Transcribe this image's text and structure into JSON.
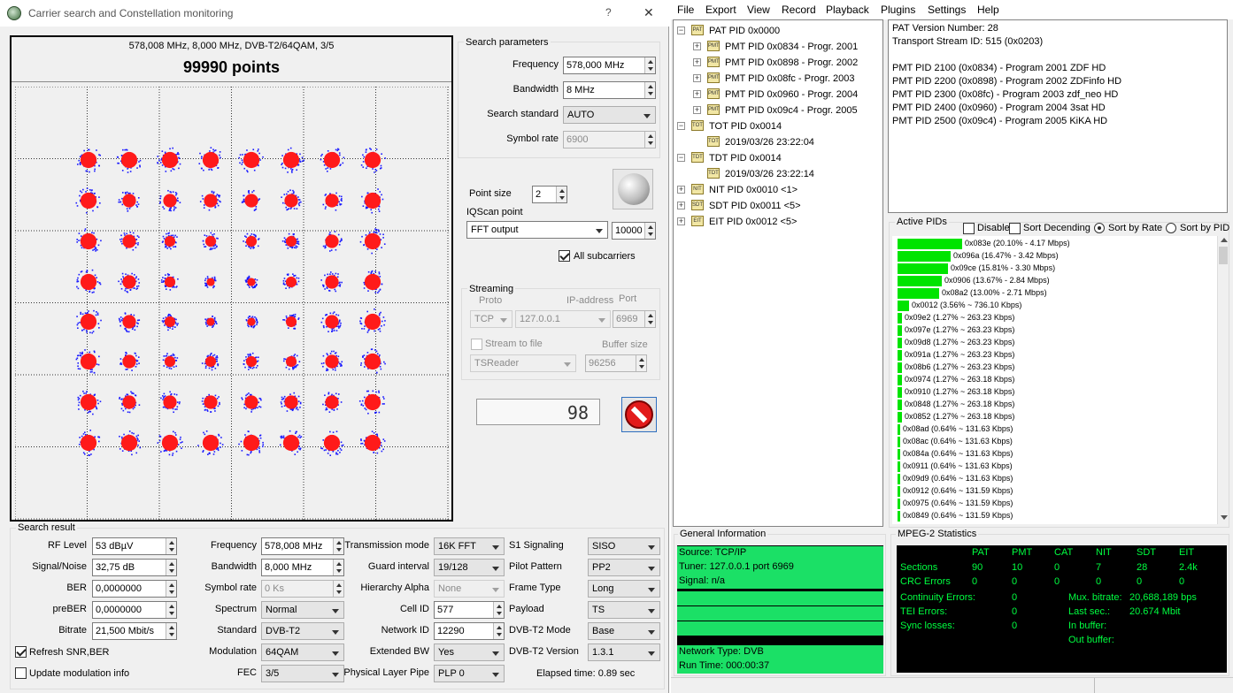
{
  "left_window": {
    "title": "Carrier search and Constellation monitoring",
    "help": "?",
    "close": "✕",
    "constellation": {
      "info_line": "578,008 MHz, 8,000 MHz, DVB-T2/64QAM, 3/5",
      "points": "99990 points"
    },
    "search_params": {
      "title": "Search parameters",
      "frequency_label": "Frequency",
      "frequency": "578,000 MHz",
      "bandwidth_label": "Bandwidth",
      "bandwidth": "8 MHz",
      "standard_label": "Search standard",
      "standard": "AUTO",
      "symbol_rate_label": "Symbol rate",
      "symbol_rate": "6900"
    },
    "point_size_label": "Point size",
    "point_size": "2",
    "iqscan_label": "IQScan point",
    "iqscan": "FFT output",
    "iqscan_count": "10000",
    "all_subcarriers": "All subcarriers",
    "streaming": {
      "title": "Streaming",
      "proto_label": "Proto",
      "ip_label": "IP-address",
      "port_label": "Port",
      "proto": "TCP",
      "ip": "127.0.0.1",
      "port": "6969",
      "stream_to_file": "Stream to file",
      "buffer_label": "Buffer size",
      "reader": "TSReader",
      "buffer": "96256"
    },
    "counter": "98",
    "search_result": {
      "title": "Search result",
      "col1": [
        {
          "label": "RF Level",
          "value": "53 dBµV"
        },
        {
          "label": "Signal/Noise",
          "value": "32,75 dB"
        },
        {
          "label": "BER",
          "value": "0,0000000"
        },
        {
          "label": "preBER",
          "value": "0,0000000"
        },
        {
          "label": "Bitrate",
          "value": "21,500 Mbit/s"
        }
      ],
      "col2": [
        {
          "label": "Frequency",
          "value": "578,008 MHz"
        },
        {
          "label": "Bandwidth",
          "value": "8,000 MHz"
        },
        {
          "label": "Symbol rate",
          "value": "0 Ks"
        },
        {
          "label": "Spectrum",
          "value": "Normal"
        },
        {
          "label": "Standard",
          "value": "DVB-T2"
        },
        {
          "label": "Modulation",
          "value": "64QAM"
        },
        {
          "label": "FEC",
          "value": "3/5"
        }
      ],
      "col3": [
        {
          "label": "Transmission mode",
          "value": "16K FFT"
        },
        {
          "label": "Guard interval",
          "value": "19/128"
        },
        {
          "label": "Hierarchy Alpha",
          "value": "None"
        },
        {
          "label": "Cell ID",
          "value": "577"
        },
        {
          "label": "Network ID",
          "value": "12290"
        },
        {
          "label": "Extended BW",
          "value": "Yes"
        },
        {
          "label": "Physical Layer Pipe",
          "value": "PLP 0"
        }
      ],
      "col4": [
        {
          "label": "S1 Signaling",
          "value": "SISO"
        },
        {
          "label": "Pilot Pattern",
          "value": "PP2"
        },
        {
          "label": "Frame Type",
          "value": "Long"
        },
        {
          "label": "Payload",
          "value": "TS"
        },
        {
          "label": "DVB-T2 Mode",
          "value": "Base"
        },
        {
          "label": "DVB-T2 Version",
          "value": "1.3.1"
        }
      ],
      "refresh": "Refresh SNR,BER",
      "update_mod": "Update modulation info",
      "elapsed": "Elapsed time: 0.89 sec"
    }
  },
  "right_window": {
    "menu": [
      "File",
      "Export",
      "View",
      "Record",
      "Playback",
      "Plugins",
      "Settings",
      "Help"
    ],
    "tree": [
      {
        "level": 0,
        "exp": "minus",
        "icon": "PAT",
        "text": "PAT PID 0x0000"
      },
      {
        "level": 1,
        "exp": "plus",
        "icon": "PMT",
        "text": "PMT PID 0x0834 - Progr. 2001"
      },
      {
        "level": 1,
        "exp": "plus",
        "icon": "PMT",
        "text": "PMT PID 0x0898 - Progr. 2002"
      },
      {
        "level": 1,
        "exp": "plus",
        "icon": "PMT",
        "text": "PMT PID 0x08fc - Progr. 2003"
      },
      {
        "level": 1,
        "exp": "plus",
        "icon": "PMT",
        "text": "PMT PID 0x0960 - Progr. 2004"
      },
      {
        "level": 1,
        "exp": "plus",
        "icon": "PMT",
        "text": "PMT PID 0x09c4 - Progr. 2005"
      },
      {
        "level": 0,
        "exp": "minus",
        "icon": "TOT",
        "text": "TOT PID 0x0014"
      },
      {
        "level": 1,
        "exp": "",
        "icon": "TOT",
        "text": "2019/03/26 23:22:04"
      },
      {
        "level": 0,
        "exp": "minus",
        "icon": "TDT",
        "text": "TDT PID 0x0014"
      },
      {
        "level": 1,
        "exp": "",
        "icon": "TDT",
        "text": "2019/03/26 23:22:14"
      },
      {
        "level": 0,
        "exp": "plus",
        "icon": "NIT",
        "text": "NIT PID 0x0010 <1>"
      },
      {
        "level": 0,
        "exp": "plus",
        "icon": "SDT",
        "text": "SDT PID 0x0011 <5>"
      },
      {
        "level": 0,
        "exp": "plus",
        "icon": "EIT",
        "text": "EIT PID 0x0012 <5>"
      }
    ],
    "info_lines": [
      "PAT Version Number: 28",
      "Transport Stream ID: 515 (0x0203)",
      "",
      "PMT PID 2100 (0x0834) - Program 2001 ZDF HD",
      "PMT PID 2200 (0x0898) - Program 2002 ZDFinfo HD",
      "PMT PID 2300 (0x08fc) - Program 2003 zdf_neo HD",
      "PMT PID 2400 (0x0960) - Program 2004 3sat HD",
      "PMT PID 2500 (0x09c4) - Program 2005 KiKA HD"
    ],
    "active_pids": {
      "title": "Active PIDs",
      "disabled": "Disabled",
      "sort_desc": "Sort Decending",
      "sort_rate": "Sort by Rate",
      "sort_pid": "Sort by PID",
      "rows": [
        {
          "pct": 20.1,
          "text": "0x083e (20.10% - 4.17 Mbps)"
        },
        {
          "pct": 16.47,
          "text": "0x096a (16.47% - 3.42 Mbps)"
        },
        {
          "pct": 15.81,
          "text": "0x09ce (15.81% - 3.30 Mbps)"
        },
        {
          "pct": 13.67,
          "text": "0x0906 (13.67% - 2.84 Mbps)"
        },
        {
          "pct": 13.0,
          "text": "0x08a2 (13.00% - 2.71 Mbps)"
        },
        {
          "pct": 3.56,
          "text": "0x0012 (3.56% ~ 736.10 Kbps)"
        },
        {
          "pct": 1.27,
          "text": "0x09e2 (1.27% ~ 263.23 Kbps)"
        },
        {
          "pct": 1.27,
          "text": "0x097e (1.27% ~ 263.23 Kbps)"
        },
        {
          "pct": 1.27,
          "text": "0x09d8 (1.27% ~ 263.23 Kbps)"
        },
        {
          "pct": 1.27,
          "text": "0x091a (1.27% ~ 263.23 Kbps)"
        },
        {
          "pct": 1.27,
          "text": "0x08b6 (1.27% ~ 263.23 Kbps)"
        },
        {
          "pct": 1.27,
          "text": "0x0974 (1.27% ~ 263.18 Kbps)"
        },
        {
          "pct": 1.27,
          "text": "0x0910 (1.27% ~ 263.18 Kbps)"
        },
        {
          "pct": 1.27,
          "text": "0x0848 (1.27% ~ 263.18 Kbps)"
        },
        {
          "pct": 1.27,
          "text": "0x0852 (1.27% ~ 263.18 Kbps)"
        },
        {
          "pct": 0.64,
          "text": "0x08ad (0.64% ~ 131.63 Kbps)"
        },
        {
          "pct": 0.64,
          "text": "0x08ac (0.64% ~ 131.63 Kbps)"
        },
        {
          "pct": 0.64,
          "text": "0x084a (0.64% ~ 131.63 Kbps)"
        },
        {
          "pct": 0.64,
          "text": "0x0911 (0.64% ~ 131.63 Kbps)"
        },
        {
          "pct": 0.64,
          "text": "0x09d9 (0.64% ~ 131.63 Kbps)"
        },
        {
          "pct": 0.64,
          "text": "0x0912 (0.64% ~ 131.59 Kbps)"
        },
        {
          "pct": 0.64,
          "text": "0x0975 (0.64% ~ 131.59 Kbps)"
        },
        {
          "pct": 0.64,
          "text": "0x0849 (0.64% ~ 131.59 Kbps)"
        }
      ]
    },
    "general_info": {
      "title": "General Information",
      "source": "Source: TCP/IP",
      "tuner": "Tuner: 127.0.0.1 port 6969",
      "signal": "Signal: n/a",
      "network": "Network Type: DVB",
      "runtime": "Run Time: 000:00:37"
    },
    "mpeg2": {
      "title": "MPEG-2 Statistics",
      "cols": [
        "PAT",
        "PMT",
        "CAT",
        "NIT",
        "SDT",
        "EIT"
      ],
      "sections_label": "Sections",
      "sections": [
        "90",
        "10",
        "0",
        "7",
        "28",
        "2.4k"
      ],
      "crc_label": "CRC Errors",
      "crc": [
        "0",
        "0",
        "0",
        "0",
        "0",
        "0"
      ],
      "cont_label": "Continuity Errors:",
      "cont": "0",
      "tei_label": "TEI Errors:",
      "tei": "0",
      "sync_label": "Sync losses:",
      "sync": "0",
      "mux_label": "Mux. bitrate:",
      "mux": "20,688,189 bps",
      "last_label": "Last sec.:",
      "last": "20.674 Mbit",
      "inbuf_label": "In buffer:",
      "outbuf_label": "Out buffer:"
    }
  },
  "colors": {
    "constellation_red": "#ff1a1a",
    "constellation_blue": "#1a1aff",
    "pid_bar": "#00e400",
    "gen_band": "#1be066"
  }
}
